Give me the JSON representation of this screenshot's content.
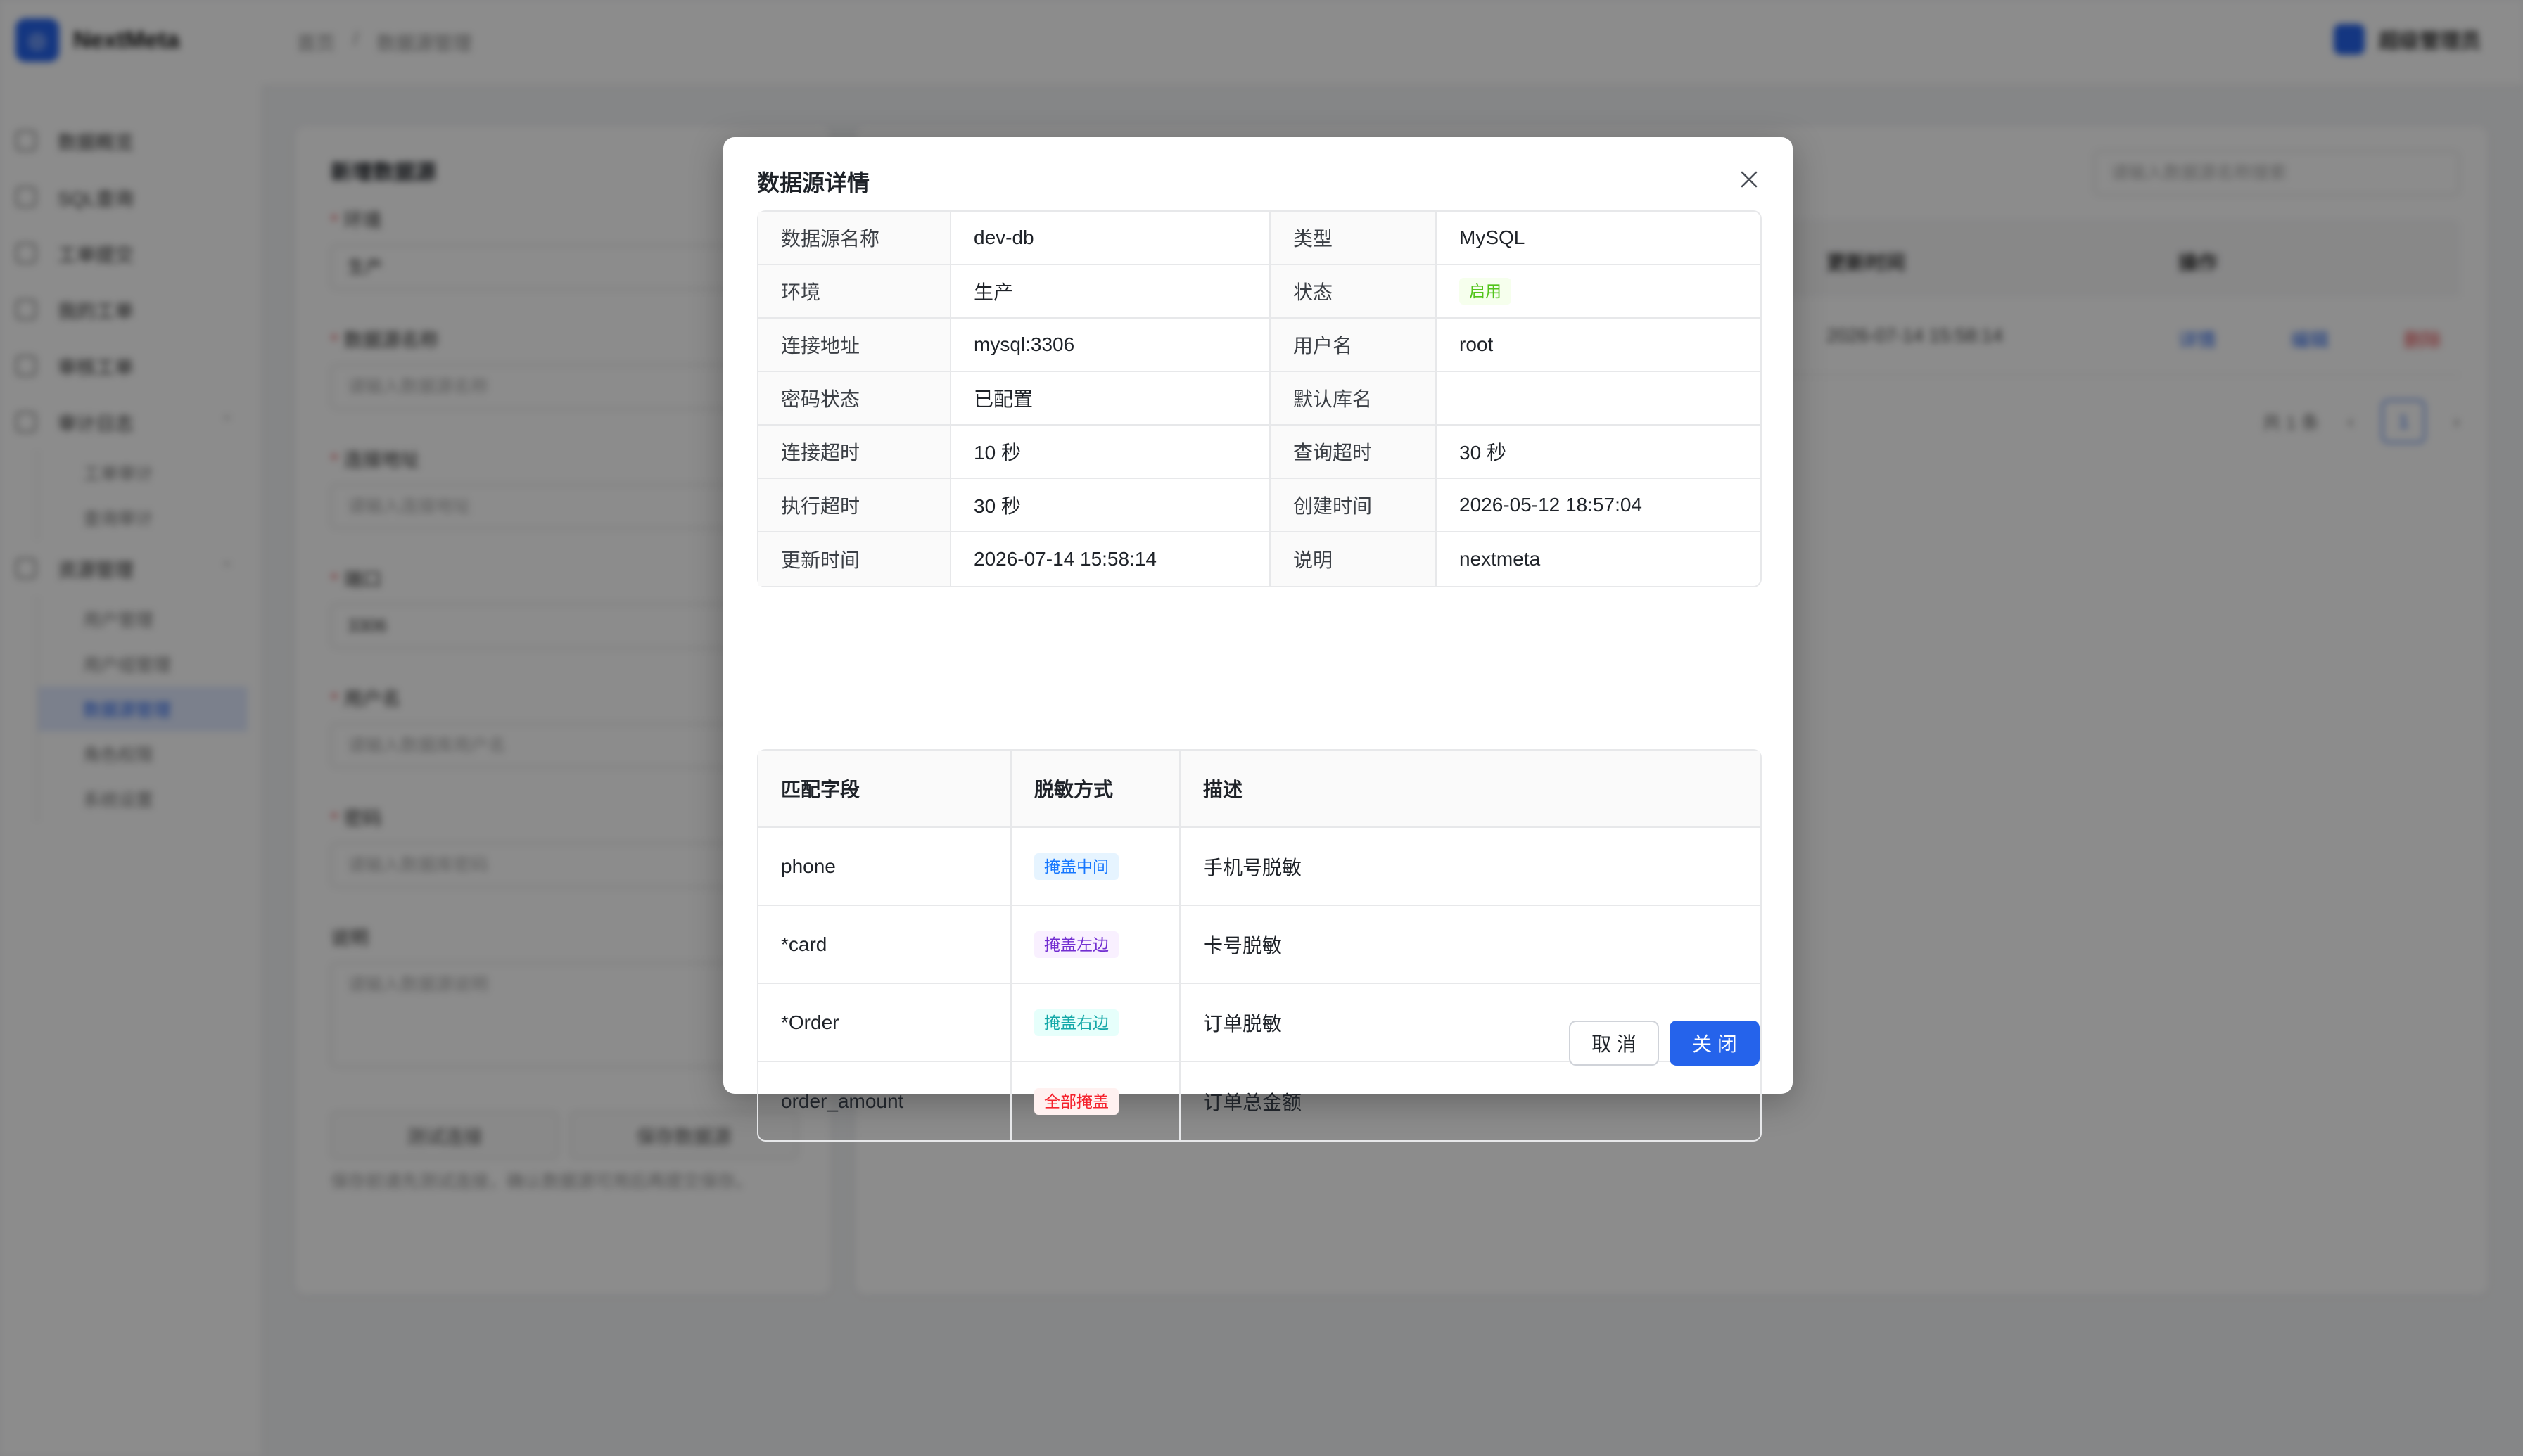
{
  "app": {
    "logo_letter": "◎",
    "name": "NextMeta"
  },
  "topbar": {
    "crumbs": [
      "首页",
      "/",
      "数据源管理"
    ],
    "user_name": "超级管理员"
  },
  "sidebar": {
    "items": [
      {
        "label": "数据概览"
      },
      {
        "label": "SQL查询"
      },
      {
        "label": "工单提交"
      },
      {
        "label": "我的工单"
      },
      {
        "label": "审核工单"
      },
      {
        "label": "审计日志"
      }
    ],
    "audit_sub": [
      "工单审计",
      "查询审计"
    ],
    "resource_group": "资源管理",
    "resource_sub": [
      "用户管理",
      "用户组管理",
      "数据源管理",
      "角色权限",
      "系统设置"
    ]
  },
  "form": {
    "title": "新增数据源",
    "env_label": "环境",
    "env_value": "生产",
    "name_label": "数据源名称",
    "name_ph": "请输入数据源名称",
    "host_label": "连接地址",
    "host_ph": "请输入连接地址",
    "port_label": "端口",
    "port_value": "3306",
    "user_label": "用户名",
    "user_ph": "请输入数据库用户名",
    "pwd_label": "密码",
    "pwd_ph": "请输入数据库密码",
    "desc_label": "说明",
    "desc_ph": "请输入数据源说明",
    "test_btn": "测试连接",
    "save_btn": "保存数据源",
    "hint": "保存前请先测试连接，确认数据源可用后再提交保存。"
  },
  "list": {
    "search_ph": "请输入数据源名称搜索",
    "col_updated": "更新时间",
    "col_ops": "操作",
    "row_updated": "2026-07-14 15:58:14",
    "op_view": "详情",
    "op_edit": "编辑",
    "op_delete": "删除",
    "pager_total": "共 1 条",
    "pager_page": "1"
  },
  "modal": {
    "title": "数据源详情",
    "info": {
      "name_label": "数据源名称",
      "name_value": "dev-db",
      "type_label": "类型",
      "type_value": "MySQL",
      "env_label": "环境",
      "env_value": "生产",
      "status_label": "状态",
      "status_value": "启用",
      "host_label": "连接地址",
      "host_value": "mysql:3306",
      "user_label": "用户名",
      "user_value": "root",
      "pwd_label": "密码状态",
      "pwd_value": "已配置",
      "db_label": "默认库名",
      "db_value": "",
      "conn_label": "连接超时",
      "conn_value": "10 秒",
      "query_label": "查询超时",
      "query_value": "30 秒",
      "exec_label": "执行超时",
      "exec_value": "30 秒",
      "created_label": "创建时间",
      "created_value": "2026-05-12 18:57:04",
      "updated_label": "更新时间",
      "updated_value": "2026-07-14 15:58:14",
      "desc_label": "说明",
      "desc_value": "nextmeta"
    },
    "mask_table": {
      "headers": [
        "匹配字段",
        "脱敏方式",
        "描述"
      ],
      "rows": [
        {
          "field": "phone",
          "method": "掩盖中间",
          "desc": "手机号脱敏"
        },
        {
          "field": "*card",
          "method": "掩盖左边",
          "desc": "卡号脱敏"
        },
        {
          "field": "*Order",
          "method": "掩盖右边",
          "desc": "订单脱敏"
        },
        {
          "field": "order_amount",
          "method": "全部掩盖",
          "desc": "订单总金额"
        }
      ]
    },
    "cancel_label": "取 消",
    "close_label": "关 闭"
  },
  "colors": {
    "primary": "#2563eb",
    "status_green": "#52c41a",
    "tag_blue": "#1677ff",
    "tag_purple": "#722ed1",
    "tag_cyan": "#13a8a8",
    "tag_red": "#f5222d"
  }
}
